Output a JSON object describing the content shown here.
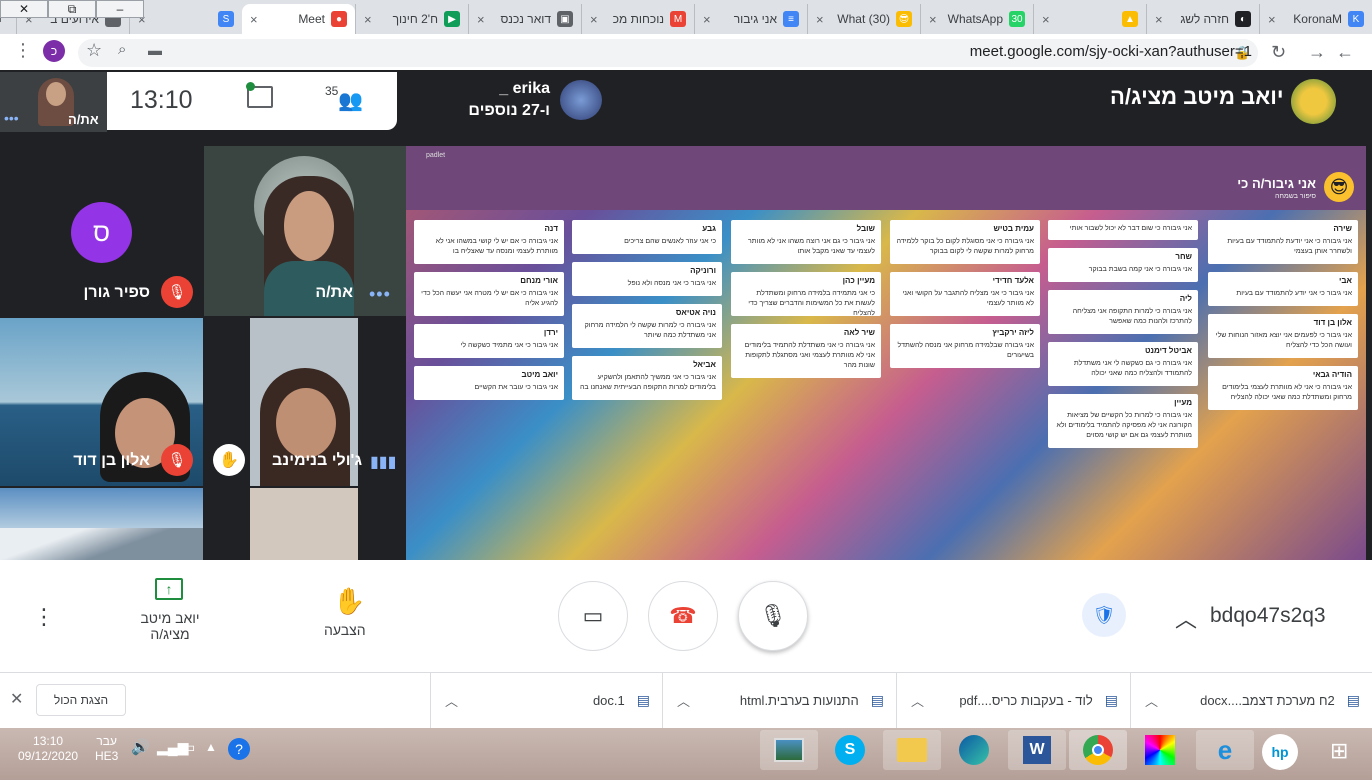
{
  "window_controls": {
    "close": "✕",
    "restore": "⧉",
    "minimize": "–"
  },
  "tabs": [
    {
      "title": "KoronaM",
      "close": "×",
      "color": "#4285f4",
      "icon": "K"
    },
    {
      "title": "חזרה לשג",
      "close": "×",
      "color": "#202124",
      "icon": "◐"
    },
    {
      "title": "",
      "close": "×",
      "color": "#fbbc04",
      "icon": "▲"
    },
    {
      "title": "WhatsApp",
      "close": "×",
      "color": "#25d366",
      "icon": "30"
    },
    {
      "title": "(30) What",
      "close": "×",
      "color": "#fbbc04",
      "icon": "😎"
    },
    {
      "title": "אני גיבור",
      "close": "×",
      "color": "#4285f4",
      "icon": "≡"
    },
    {
      "title": "נוכחות מכ",
      "close": "×",
      "color": "#ea4335",
      "icon": "M"
    },
    {
      "title": "דואר נכנס",
      "close": "×",
      "color": "#5f6368",
      "icon": "▣"
    },
    {
      "title": "ח'2 חינוך",
      "close": "×",
      "color": "#0f9d58",
      "icon": "▶"
    },
    {
      "title": "Meet",
      "close": "×",
      "color": "#ea4335",
      "icon": "●",
      "active": true
    },
    {
      "title": "",
      "close": "×",
      "color": "#4285f4",
      "icon": "S"
    },
    {
      "title": "אירועים ב",
      "close": "×",
      "color": "#5f6368",
      "icon": ""
    }
  ],
  "new_tab": "+",
  "address": {
    "url": "meet.google.com/sjy-ocki-xan?authuser=1",
    "profile_letter": "כ"
  },
  "meet": {
    "self_label": "את/ה",
    "clock": "13:10",
    "participants_count": "35",
    "erika_name": "_ erika",
    "erika_more": "ו-27 נוספים",
    "presenter_label": "יואב מיטב מציג/ה",
    "tiles": [
      {
        "name": "ספיר גורן",
        "avatar": "ס"
      },
      {
        "name": "את/ה"
      },
      {
        "name": "אלון בן דוד"
      },
      {
        "name": "ג'ולי בנימינב"
      }
    ]
  },
  "padlet": {
    "brand": "padlet",
    "title": "אני גיבור/ה כי",
    "subtitle": "סיפור בשמחה",
    "columns": [
      [
        {
          "t": "שירה",
          "b": "אני גיבורה כי אני יודעת להתמודד עם בעיות ולשחרר אותן בעצמי"
        },
        {
          "t": "אבי",
          "b": "אני גיבור כי אני יודע להתמודד עם בעיות"
        },
        {
          "t": "אלון בן דוד",
          "b": "אני גיבור כי לפעמים אני יוצא מאזור הנוחות שלי ועושה הכל כדי להצליח"
        },
        {
          "t": "הודיה גבאי",
          "b": "אני גיבורה כי אני לא מוותרת לעצמי בלימודים מרחוק ומשתדלת כמה שאני יכולה להצליח"
        }
      ],
      [
        {
          "t": "",
          "b": "אני גיבורה כי שום דבר לא יכול לשבור אותי"
        },
        {
          "t": "שחר",
          "b": "אני גיבורה כי אני קמה בשבת בבוקר"
        },
        {
          "t": "ליה",
          "b": "אני גיבורה כי למרות התקופה אני מצליחה להתרכז ולהנות כמה שאפשר"
        },
        {
          "t": "אביטל דימנט",
          "b": "אני גיבורה כי גם כשקשה לי אני משתדלת להתמודד ולהצליח כמה שאני יכולה"
        },
        {
          "t": "מעיין",
          "b": "אני גיבורה כי למרות כל הקשיים של מציאות הקורונה אני לא מפסיקה להתמיד בלימודים ולא מוותרת לעצמי גם אם יש קושי מסוים"
        }
      ],
      [
        {
          "t": "עמית בטיש",
          "b": "אני גיבורה כי אני מסוגלת לקום כל בוקר ללמידה מרחוק למרות שקשה לי לקום בבוקר"
        },
        {
          "t": "אלעד חדידי",
          "b": "אני גיבור כי אני מצליח להתגבר על הקושי ואני לא מוותר לעצמי"
        },
        {
          "t": "ליזה ירקביץ",
          "b": "אני גיבורה שבלמידה מרחוק אני מנסה להשתדל בשיעורים"
        }
      ],
      [
        {
          "t": "שובל",
          "b": "אני גיבור כי גם אני רוצה משהו אני לא מוותר לעצמי עד שאני מקבל אותו"
        },
        {
          "t": "מעיין כהן",
          "b": "כי אני מתמידה בלמידה מרחוק ומשתדלת לעשות את כל המשימות והדברים שצריך כדי להצליח"
        },
        {
          "t": "שיר לאה",
          "b": "אני גיבורה כי אני משתדלת להתמיד בלימודים אני לא מוותרת לעצמי ואני מסתגלת לתקופות שונות מהר"
        }
      ],
      [
        {
          "t": "גבע",
          "b": "כי אני עוזר לאנשים שהם צריכים"
        },
        {
          "t": "ורוניקה",
          "b": "אני גיבור כי אני מנסה ולא נופל"
        },
        {
          "t": "נויה אטיאס",
          "b": "אני גיבורה כי למרות שקשה לי הלמידה מרחוק אני משתדלת כמה שיותר"
        },
        {
          "t": "אביאל",
          "b": "אני גיבור כי אני ממשיך להתאמן ולהשקיע בלימודים למרות התקופה הבעייתית שאנחנו בה"
        }
      ],
      [
        {
          "t": "דנה",
          "b": "אני גיבורה כי אם יש לי קושי במשהו אני לא מוותרת לעצמי ומנסה עד שאצליח בו"
        },
        {
          "t": "אורי מנחם",
          "b": "אני גיבורה כי אם יש לי מטרה אני יעשה הכל כדי להגיע אליה"
        },
        {
          "t": "ירדן",
          "b": "אני גיבור כי אני מתמיד כשקשה לי"
        },
        {
          "t": "יואב מיטב",
          "b": "אני גיבור כי עובר את הקשיים"
        }
      ]
    ]
  },
  "toolbar": {
    "meeting_code": "bdqo47s2q3",
    "raise_hand": "הצבעה",
    "presenting_line1": "יואב מיטב",
    "presenting_line2": "מציג/ה"
  },
  "downloads": [
    {
      "name": "2ח מערכת דצמב....docx"
    },
    {
      "name": "לוד - בעקבות כריס....pdf"
    },
    {
      "name": "התנועות בערבית.html"
    },
    {
      "name": "1.doc"
    }
  ],
  "downloads_show_all": "הצגת הכול",
  "taskbar": {
    "time": "13:10",
    "date": "09/12/2020",
    "lang": "עבר",
    "lang2": "HE3"
  }
}
